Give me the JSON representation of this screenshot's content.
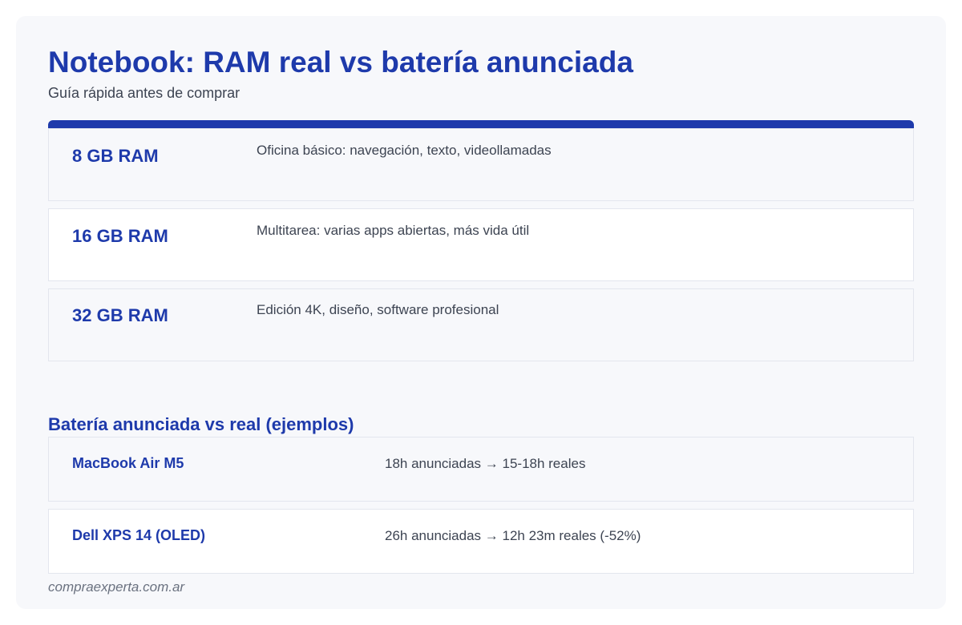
{
  "header": {
    "title": "Notebook: RAM real vs batería anunciada",
    "subtitle": "Guía rápida antes de comprar"
  },
  "ram_guide": [
    {
      "label": "8 GB RAM",
      "description": "Oficina básico: navegación, texto, videollamadas"
    },
    {
      "label": "16 GB RAM",
      "description": "Multitarea: varias apps abiertas, más vida útil"
    },
    {
      "label": "32 GB RAM",
      "description": "Edición 4K, diseño, software profesional"
    }
  ],
  "battery": {
    "title": "Batería anunciada vs real (ejemplos)",
    "items": [
      {
        "model": "MacBook Air M5",
        "detail": "18h anunciadas → 15-18h reales"
      },
      {
        "model": "Dell XPS 14 (OLED)",
        "detail": "26h anunciadas → 12h 23m reales (-52%)"
      }
    ]
  },
  "footer": {
    "source": "compraexperta.com.ar"
  },
  "colors": {
    "accent": "#1e3aab",
    "text": "#3d4452",
    "background": "#f7f8fb",
    "muted": "#6b7280"
  }
}
